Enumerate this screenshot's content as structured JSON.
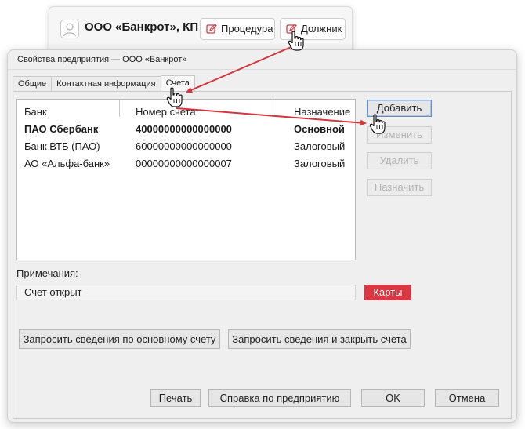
{
  "top_card": {
    "org_name": "ООО «Банкрот», КП",
    "buttons": {
      "procedure": "Процедура",
      "debtor": "Должник"
    }
  },
  "dialog": {
    "title": "Свойства предприятия — ООО «Банкрот»",
    "tabs": [
      {
        "label": "Общие",
        "active": false
      },
      {
        "label": "Контактная информация",
        "active": false
      },
      {
        "label": "Счета",
        "active": true
      }
    ],
    "accounts": {
      "columns": [
        "Банк",
        "Номер счета",
        "Назначение"
      ],
      "rows": [
        {
          "bank": "ПАО Сбербанк",
          "number": "40000000000000000",
          "purpose": "Основной",
          "bold": true
        },
        {
          "bank": "Банк ВТБ (ПАО)",
          "number": "60000000000000000",
          "purpose": "Залоговый",
          "bold": false
        },
        {
          "bank": "АО «Альфа-банк»",
          "number": "00000000000000007",
          "purpose": "Залоговый",
          "bold": false
        }
      ]
    },
    "side_buttons": {
      "add": "Добавить",
      "edit": "Изменить",
      "delete": "Удалить",
      "assign": "Назначить"
    },
    "notes": {
      "label": "Примечания:",
      "value": "Счет открыт"
    },
    "cards_button": "Карты",
    "request_buttons": {
      "main": "Запросить сведения по основному счету",
      "close": "Запросить сведения и закрыть счета"
    },
    "footer_buttons": {
      "print": "Печать",
      "reference": "Справка по предприятию",
      "ok": "OK",
      "cancel": "Отмена"
    }
  },
  "colors": {
    "accent_red": "#d93842",
    "arrow_red": "#d0383e",
    "primary_border": "#6b8ec8"
  },
  "icons": {
    "avatar": "user-avatar-icon",
    "edit": "edit-pencil-icon",
    "cursor": "hand-pointer-icon"
  }
}
